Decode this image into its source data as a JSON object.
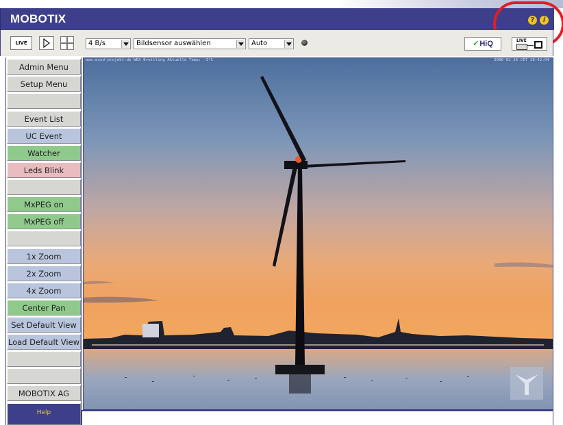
{
  "header": {
    "logo": "MOBOTIX",
    "help_icon": "?",
    "info_icon": "i"
  },
  "toolbar": {
    "live_label": "LIVE",
    "play_icon": "play-icon",
    "frame_rate": "4 B/s",
    "sensor_select": "Bildsensor auswählen",
    "mode_select": "Auto",
    "hiq_label": "HiQ",
    "live_export_label": "LIVE"
  },
  "sidebar": {
    "items": [
      {
        "label": "Admin Menu",
        "color": "gray"
      },
      {
        "label": "Setup Menu",
        "color": "gray"
      },
      {
        "label": "",
        "color": "gray"
      },
      {
        "label": "Event List",
        "color": "gray"
      },
      {
        "label": "UC Event",
        "color": "blue"
      },
      {
        "label": "Watcher",
        "color": "green"
      },
      {
        "label": "Leds Blink",
        "color": "pink"
      },
      {
        "label": "",
        "color": "gray"
      },
      {
        "label": "MxPEG on",
        "color": "green"
      },
      {
        "label": "MxPEG off",
        "color": "green"
      },
      {
        "label": "",
        "color": "gray"
      },
      {
        "label": "1x Zoom",
        "color": "blue"
      },
      {
        "label": "2x Zoom",
        "color": "blue"
      },
      {
        "label": "4x Zoom",
        "color": "blue"
      },
      {
        "label": "Center Pan",
        "color": "green"
      },
      {
        "label": "Set Default View",
        "color": "blue"
      },
      {
        "label": "Load Default View",
        "color": "blue"
      },
      {
        "label": "",
        "color": "gray"
      },
      {
        "label": "",
        "color": "gray"
      },
      {
        "label": "MOBOTIX AG",
        "color": "gray"
      },
      {
        "label": "Help",
        "color": "help"
      }
    ]
  },
  "video": {
    "overlay_left": "www.wind-projekt.de  WEA Breitling  Aktuelle Temp: -3°C",
    "overlay_right": "2006-02-26 CET 18:42:04"
  },
  "colors": {
    "brand": "#3d3f8a",
    "highlight_ring": "#e01e24"
  }
}
